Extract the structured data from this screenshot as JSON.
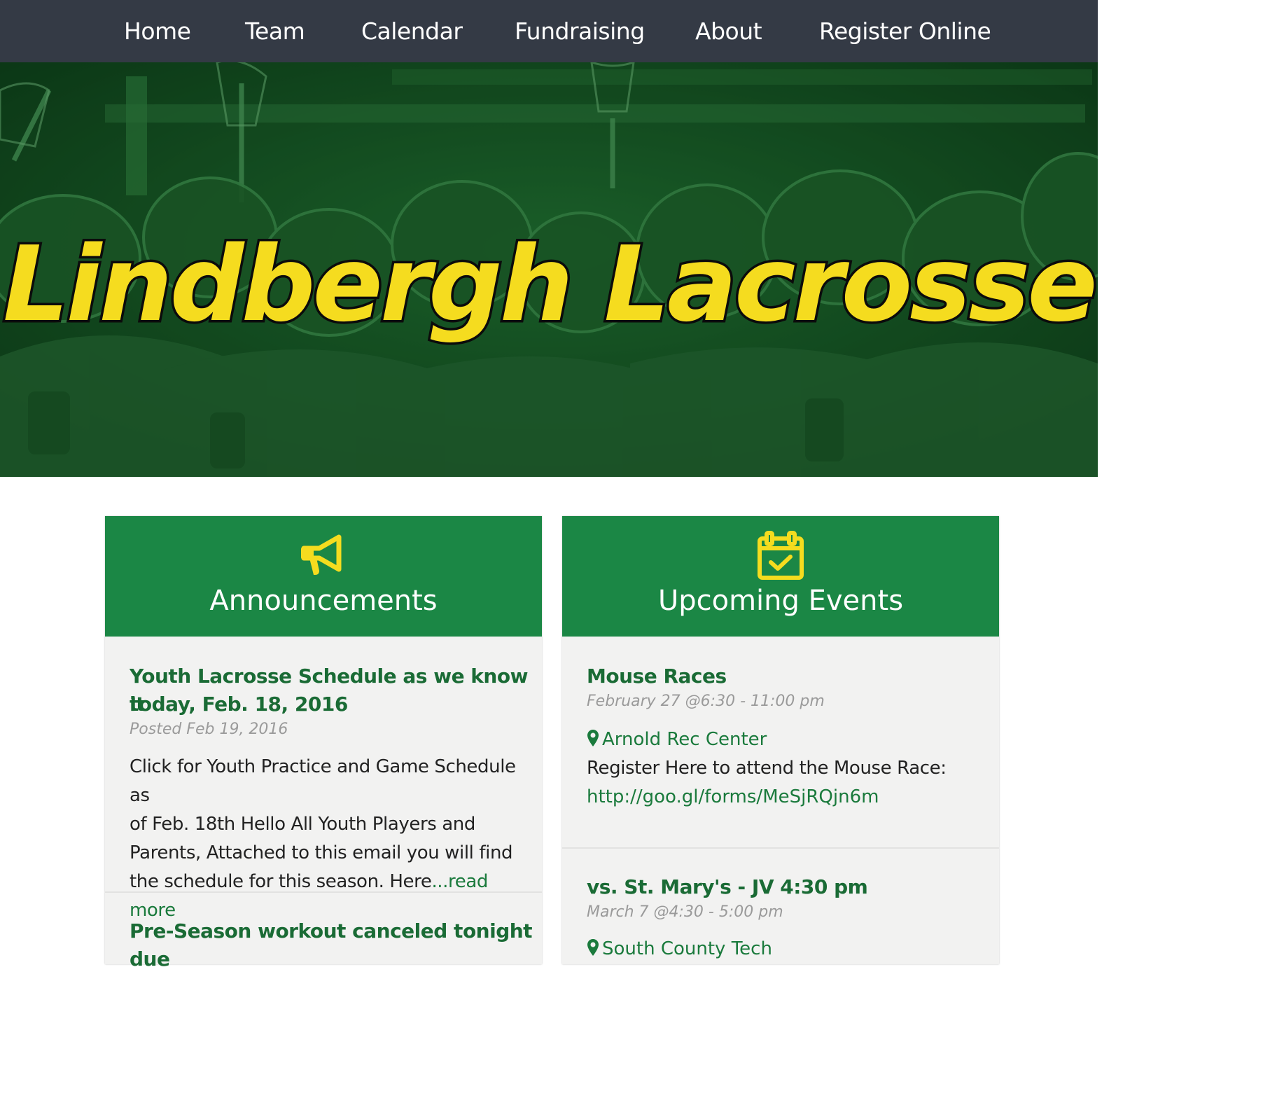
{
  "nav": {
    "items": [
      {
        "label": "Home"
      },
      {
        "label": "Team"
      },
      {
        "label": "Calendar"
      },
      {
        "label": "Fundraising"
      },
      {
        "label": "About"
      },
      {
        "label": "Register Online"
      }
    ]
  },
  "hero": {
    "title": "Lindbergh Lacrosse"
  },
  "announcements": {
    "heading": "Announcements",
    "icon": "megaphone-icon",
    "items": [
      {
        "title_line1": "Youth Lacrosse Schedule as we know it",
        "title_line2": "today, Feb. 18, 2016",
        "posted": "Posted Feb 19, 2016",
        "excerpt_line1": "Click for Youth Practice and Game Schedule as",
        "excerpt_line2": "of Feb. 18th Hello All Youth Players and",
        "excerpt_line3": "Parents, Attached to this email you will find",
        "excerpt_line4": "the schedule for this season. Here",
        "read_more": "...read more"
      },
      {
        "title_line1": "Pre-Season workout canceled tonight due"
      }
    ]
  },
  "events": {
    "heading": "Upcoming Events",
    "icon": "calendar-check-icon",
    "items": [
      {
        "title": "Mouse Races",
        "date": "February 27 @6:30  - 11:00 pm",
        "location": "Arnold Rec Center",
        "description": "Register Here to attend the Mouse Race:",
        "link": "http://goo.gl/forms/MeSjRQjn6m"
      },
      {
        "title": "vs. St. Mary's - JV 4:30 pm",
        "date": "March 7 @4:30  - 5:00 pm",
        "location": "South County Tech"
      }
    ]
  },
  "colors": {
    "nav_bg": "#343a45",
    "panel_header": "#1b8745",
    "accent_yellow": "#f5dc1f",
    "link_green": "#1a7a3c"
  }
}
